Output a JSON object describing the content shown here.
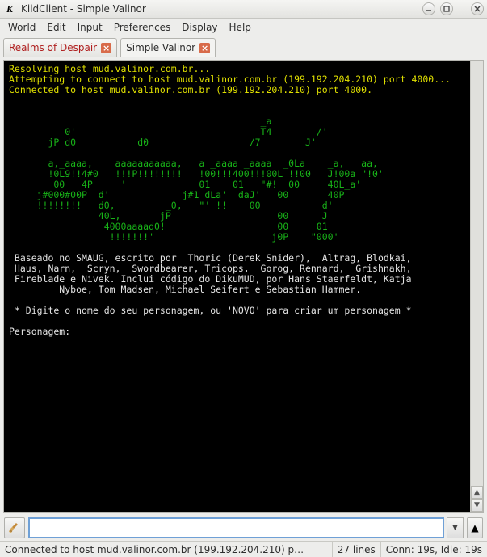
{
  "window": {
    "title": "KildClient - Simple Valinor",
    "app_icon": "K"
  },
  "menu": {
    "items": [
      "World",
      "Edit",
      "Input",
      "Preferences",
      "Display",
      "Help"
    ]
  },
  "tabs": [
    {
      "label": "Realms of Despair",
      "color": "red"
    },
    {
      "label": "Simple Valinor",
      "color": "normal",
      "active": true
    }
  ],
  "terminal": {
    "line1": "Resolving host mud.valinor.com.br...",
    "line2": "Attempting to connect to host mud.valinor.com.br (199.192.204.210) port 4000...",
    "line3": "Connected to host mud.valinor.com.br (199.192.204.210) port 4000.",
    "ascii": "\n\n                                             _a\n          0'                                _T4        /'\n       jP d0           d0                  /7        J'\n                       __\n       a,_aaaa,    aaaaaaaaaaa,   a _aaaa _aaaa  _0La    _a,   aa,\n       !0L9!!4#0   !!!P!!!!!!!!   !00!!!400!!!00L !!00   J!00a \"!0'\n        00   4P     '             01    01   \"#!  00     40L_a'\n     j#000#00P  d'             j#1_dLa' _daJ'   00       40P\n     !!!!!!!!   d0,         _0,   \"' !!    00           d'\n                40L,       jP                   00      J\n                 4000aaaad0!                    00     01\n                  !!!!!!!'                     j0P    \"000'\n",
    "body": "\n Baseado no SMAUG, escrito por  Thoric (Derek Snider),  Altrag, Blodkai,\n Haus, Narn,  Scryn,  Swordbearer, Tricops,  Gorog, Rennard,  Grishnakh,\n Fireblade e Nivek. Inclui código do DikuMUD, por Hans Staerfeldt, Katja\n         Nyboe, Tom Madsen, Michael Seifert e Sebastian Hammer.\n\n * Digite o nome do seu personagem, ou 'NOVO' para criar um personagem *\n\nPersonagem:\n"
  },
  "input": {
    "value": "",
    "placeholder": ""
  },
  "status": {
    "connected": "Connected to host mud.valinor.com.br (199.192.204.210) p…",
    "lines": "27 lines",
    "conn": "Conn: 19s, Idle: 19s"
  }
}
